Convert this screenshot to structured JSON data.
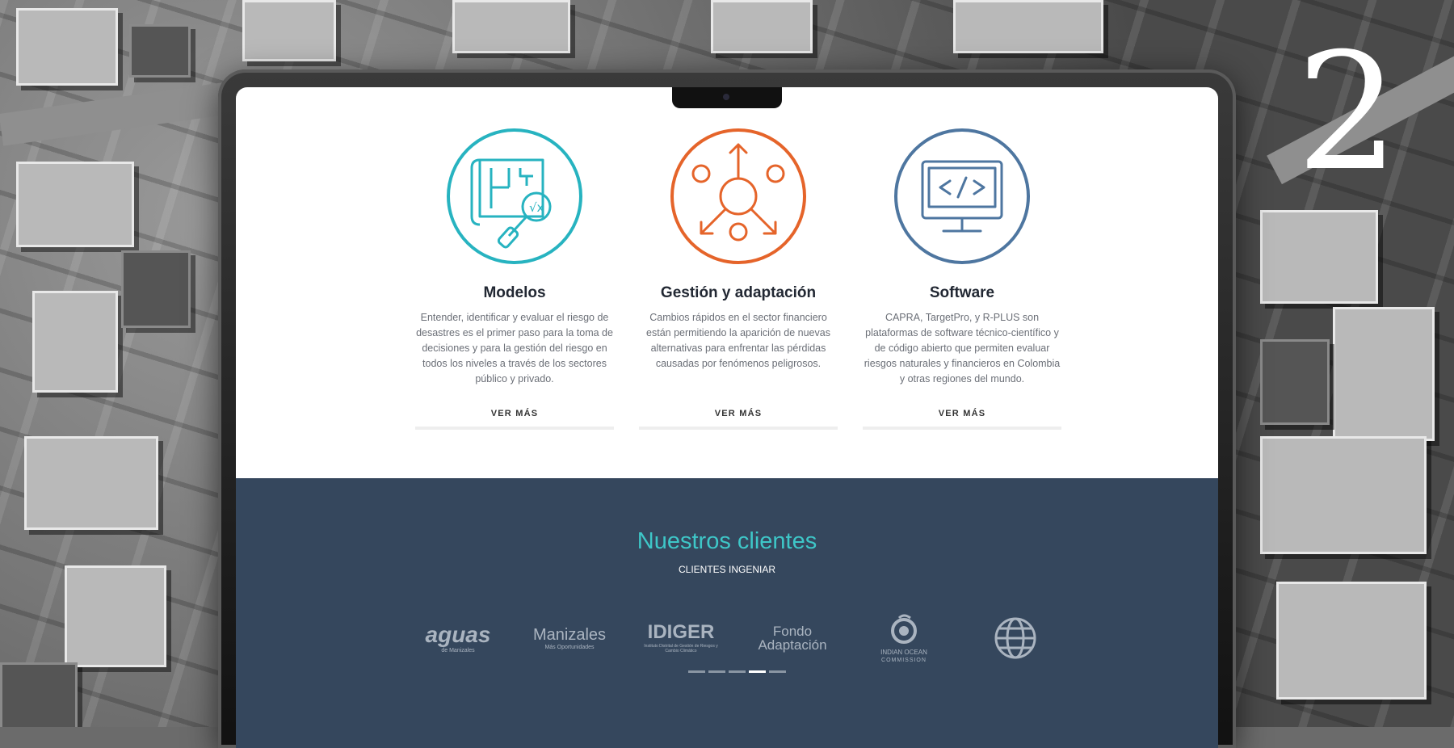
{
  "overlay": {
    "big_number": "2"
  },
  "services": [
    {
      "title": "Modelos",
      "text": "Entender, identificar y evaluar el riesgo de desastres es el primer paso para la toma de decisiones y para la gestión del riesgo en todos los niveles a través de los sectores público y privado.",
      "button": "VER MÁS",
      "icon": "blueprint-magnifier-icon",
      "color": "#27b3c0"
    },
    {
      "title": "Gestión y adaptación",
      "text": "Cambios rápidos en el sector financiero están permitiendo la aparición de nuevas alternativas para enfrentar las pérdidas causadas por fenómenos peligrosos.",
      "button": "VER MÁS",
      "icon": "network-arrows-icon",
      "color": "#e5642a"
    },
    {
      "title": "Software",
      "text": "CAPRA, TargetPro, y R-PLUS son plataformas de software técnico-científico y de código abierto que permiten evaluar riesgos naturales y financieros en Colombia y otras regiones del mundo.",
      "button": "VER MÁS",
      "icon": "monitor-code-icon",
      "color": "#4e76a0"
    }
  ],
  "clients": {
    "title": "Nuestros clientes",
    "subtitle": "CLIENTES INGENIAR",
    "logos": [
      {
        "name": "aguas-de-manizales-logo",
        "text": "aguas",
        "sub": "de Manizales"
      },
      {
        "name": "alcaldia-manizales-logo",
        "text": "Manizales",
        "sub": "Más Oportunidades"
      },
      {
        "name": "idiger-logo",
        "text": "IDIGER",
        "sub": "Instituto Distrital de Gestión de Riesgos y Cambio Climático"
      },
      {
        "name": "fondo-adaptacion-logo",
        "text": "Fondo Adaptación",
        "sub": ""
      },
      {
        "name": "indian-ocean-commission-logo",
        "text": "INDIAN OCEAN",
        "sub": "COMMISSION"
      },
      {
        "name": "world-bank-logo",
        "text": "",
        "sub": ""
      }
    ],
    "carousel": {
      "count": 5,
      "active_index": 3
    }
  }
}
